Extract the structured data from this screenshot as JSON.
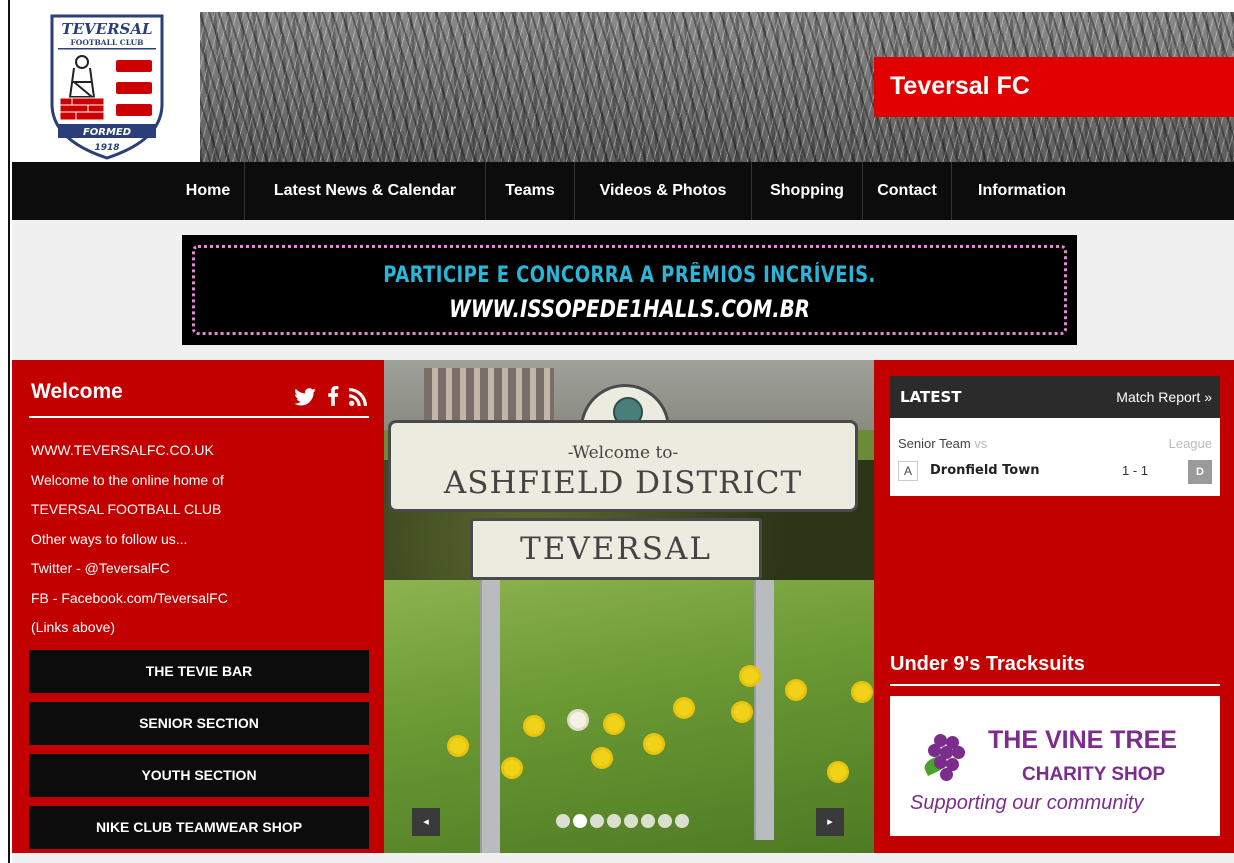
{
  "logo": {
    "club_name": "TEVERSAL",
    "club_sub": "FOOTBALL CLUB",
    "formed": "FORMED",
    "year": "1918"
  },
  "header": {
    "site_title": "Teversal FC"
  },
  "nav": {
    "items": [
      "Home",
      "Latest News & Calendar",
      "Teams",
      "Videos & Photos",
      "Shopping",
      "Contact",
      "Information"
    ]
  },
  "ad": {
    "line1": "PARTICIPE E CONCORRA A PRÊMIOS INCRÍVEIS.",
    "line2": "WWW.ISSOPEDE1HALLS.COM.BR"
  },
  "welcome": {
    "title": "Welcome",
    "social_icons": [
      "twitter-icon",
      "facebook-icon",
      "rss-icon"
    ],
    "lines": [
      "WWW.TEVERSALFC.CO.UK",
      "Welcome to the online home of",
      "TEVERSAL FOOTBALL CLUB",
      "Other ways to follow us...",
      "Twitter - @TeversalFC",
      "FB - Facebook.com/TeversalFC",
      "(Links above)"
    ],
    "buttons": [
      "THE TEVIE BAR",
      "SENIOR SECTION",
      "YOUTH SECTION",
      "NIKE CLUB TEAMWEAR SHOP"
    ]
  },
  "slider": {
    "sign_welcome": "-Welcome to-",
    "sign_district": "ASHFIELD DISTRICT",
    "sign_town": "TEVERSAL",
    "prev_label": "◂",
    "next_label": "▸",
    "slide_count": 8,
    "active_slide": 1
  },
  "latest": {
    "title": "LATEST",
    "link": "Match Report »",
    "team": "Senior Team",
    "vs": "vs",
    "competition": "League",
    "home_away": "A",
    "opponent": "Dronfield Town",
    "score": "1 - 1",
    "result": "D"
  },
  "promo": {
    "title": "Under 9's Tracksuits",
    "shop_name": "THE VINE TREE",
    "shop_sub": "CHARITY SHOP",
    "shop_tagline": "Supporting our community"
  },
  "colors": {
    "brand_red": "#c30000",
    "title_red": "#e00000",
    "nav_black": "#0c0c0c",
    "vine_purple": "#7b2c8c"
  }
}
